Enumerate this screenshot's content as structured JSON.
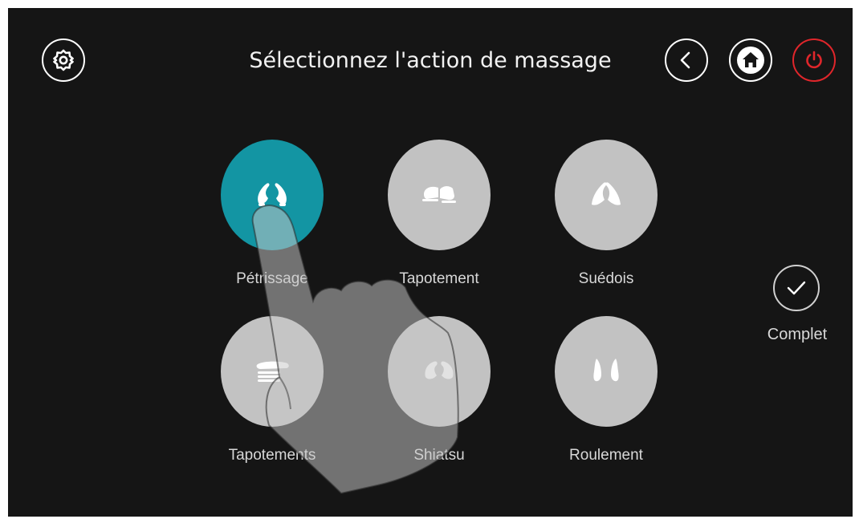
{
  "header": {
    "title": "Sélectionnez l'action de massage"
  },
  "icons": {
    "settings": "gear-icon",
    "back": "chevron-left-icon",
    "home": "home-icon",
    "power": "power-icon",
    "complete": "checkmark-icon"
  },
  "actions": [
    {
      "label": "Pétrissage",
      "icon": "kneading-hands-icon",
      "selected": true
    },
    {
      "label": "Tapotement",
      "icon": "tapping-hands-icon",
      "selected": false
    },
    {
      "label": "Suédois",
      "icon": "swedish-hands-icon",
      "selected": false
    },
    {
      "label": "Tapotements",
      "icon": "flat-hand-tapping-icon",
      "selected": false
    },
    {
      "label": "Shiatsu",
      "icon": "shiatsu-hands-icon",
      "selected": false
    },
    {
      "label": "Roulement",
      "icon": "rolling-hands-icon",
      "selected": false
    }
  ],
  "complete": {
    "label": "Complet"
  },
  "colors": {
    "background": "#151515",
    "accent": "#1395a3",
    "inactive": "#c2c2c2",
    "power": "#e0262b",
    "text": "#f2f2f2"
  }
}
